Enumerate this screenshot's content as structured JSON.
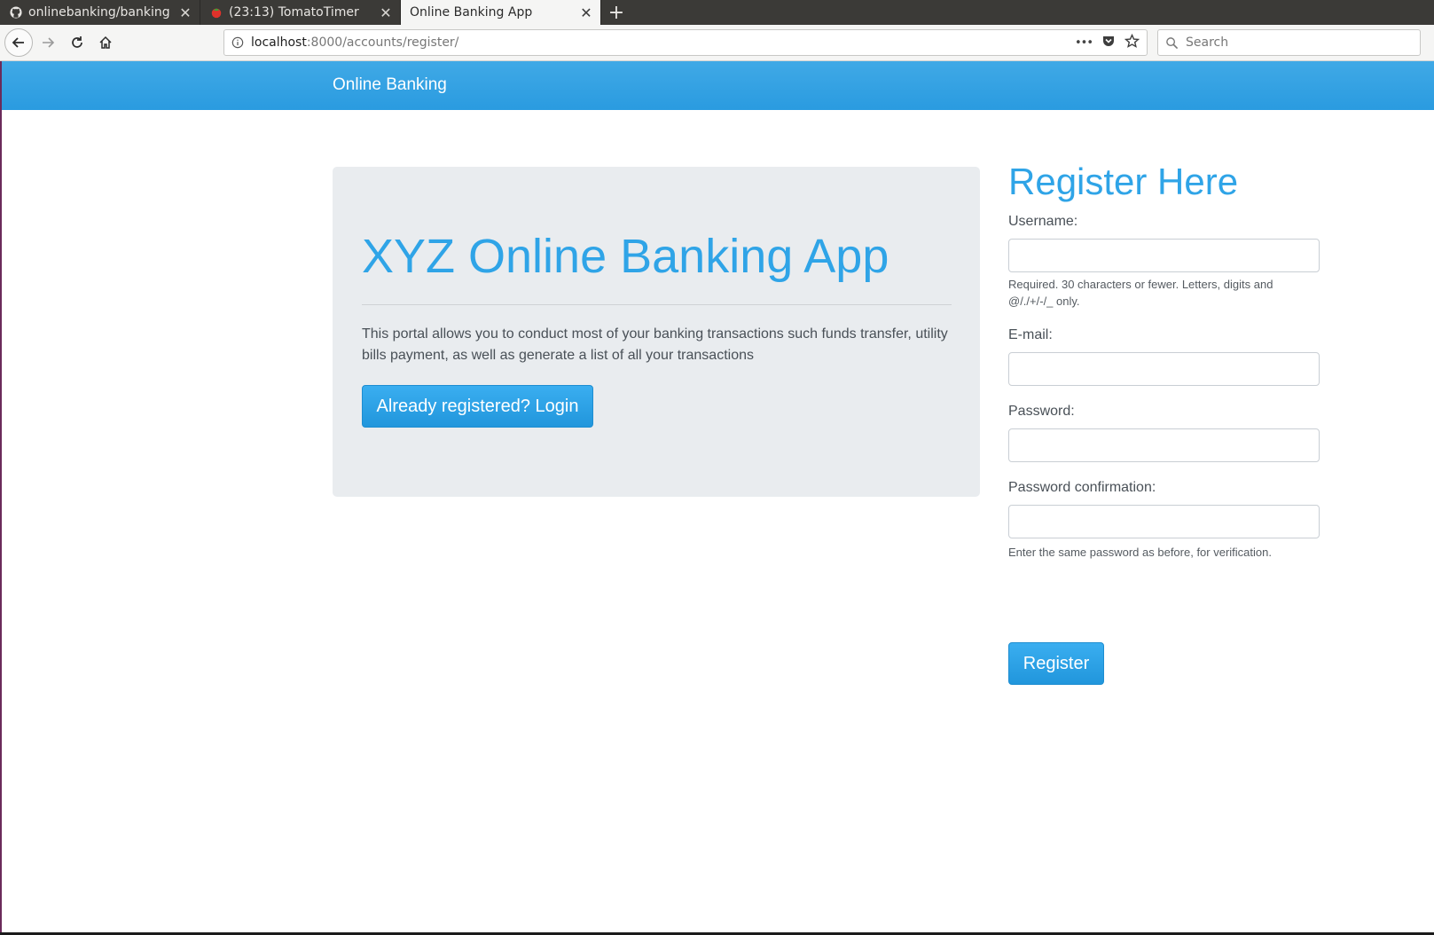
{
  "browser": {
    "tabs": [
      {
        "title": "onlinebanking/banking",
        "icon": "github-icon",
        "active": false
      },
      {
        "title": "(23:13) TomatoTimer",
        "icon": "tomato-icon",
        "active": false
      },
      {
        "title": "Online Banking App",
        "icon": "",
        "active": true
      }
    ],
    "new_tab_label": "+",
    "url_host": "localhost",
    "url_path": ":8000/accounts/register/",
    "search_placeholder": "Search",
    "url_actions_more": "•••"
  },
  "site": {
    "brand": "Online Banking"
  },
  "jumbotron": {
    "title": "XYZ Online Banking App",
    "text": "This portal allows you to conduct most of your banking transactions such funds transfer, utility bills payment, as well as generate a list of all your transactions",
    "login_button": "Already registered? Login"
  },
  "register": {
    "title": "Register Here",
    "username_label": "Username:",
    "username_help": "Required. 30 characters or fewer. Letters, digits and @/./+/-/_ only.",
    "email_label": "E-mail:",
    "password_label": "Password:",
    "password_confirm_label": "Password confirmation:",
    "password_confirm_help": "Enter the same password as before, for verification.",
    "submit_button": "Register"
  },
  "colors": {
    "accent": "#2fa4e7",
    "header": "#2a9be0"
  }
}
